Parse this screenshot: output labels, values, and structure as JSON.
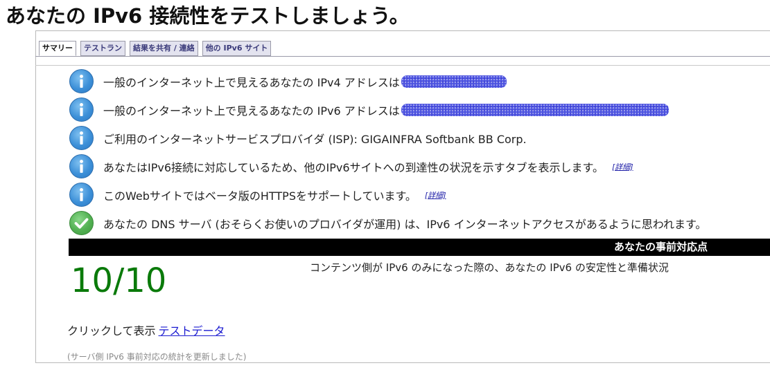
{
  "page_title": "あなたの IPv6 接続性をテストしましょう。",
  "tabs": [
    {
      "label": "サマリー",
      "active": true
    },
    {
      "label": "テストラン",
      "active": false
    },
    {
      "label": "結果を共有 / 連絡",
      "active": false
    },
    {
      "label": "他の IPv6 サイト",
      "active": false
    }
  ],
  "results": [
    {
      "icon": "info-icon",
      "text": "一般のインターネット上で見えるあなたの IPv4 アドレスは",
      "redacted": true
    },
    {
      "icon": "info-icon",
      "text": "一般のインターネット上で見えるあなたの IPv6 アドレスは",
      "redacted": true
    },
    {
      "icon": "info-icon",
      "text": "ご利用のインターネットサービスプロバイダ (ISP): GIGAINFRA Softbank BB Corp."
    },
    {
      "icon": "info-icon",
      "text": "あなたはIPv6接続に対応しているため、他のIPv6サイトへの到達性の状況を示すタブを表示します。",
      "link": "[詳細]"
    },
    {
      "icon": "info-icon",
      "text": "このWebサイトではベータ版のHTTPSをサポートしています。",
      "link": "[詳細]"
    },
    {
      "icon": "checkmark-icon",
      "text": "あなたの DNS サーバ (おそらくお使いのプロバイダが運用) は、IPv6 インターネットアクセスがあるように思われます。"
    }
  ],
  "score": {
    "header": "あなたの事前対応点",
    "value": "10/10",
    "description": "コンテンツ側が IPv6 のみになった際の、あなたの IPv6 の安定性と準備状況"
  },
  "test_data": {
    "prefix": "クリックして表示",
    "link": "テストデータ"
  },
  "footnote": "(サーバ側 IPv6 事前対応の統計を更新しました)",
  "colors": {
    "score": "#0a7a0a",
    "info_icon": "#3d90d8",
    "ok_icon": "#52b052",
    "redaction": "#4b52e0",
    "link": "#1a1ad0"
  }
}
